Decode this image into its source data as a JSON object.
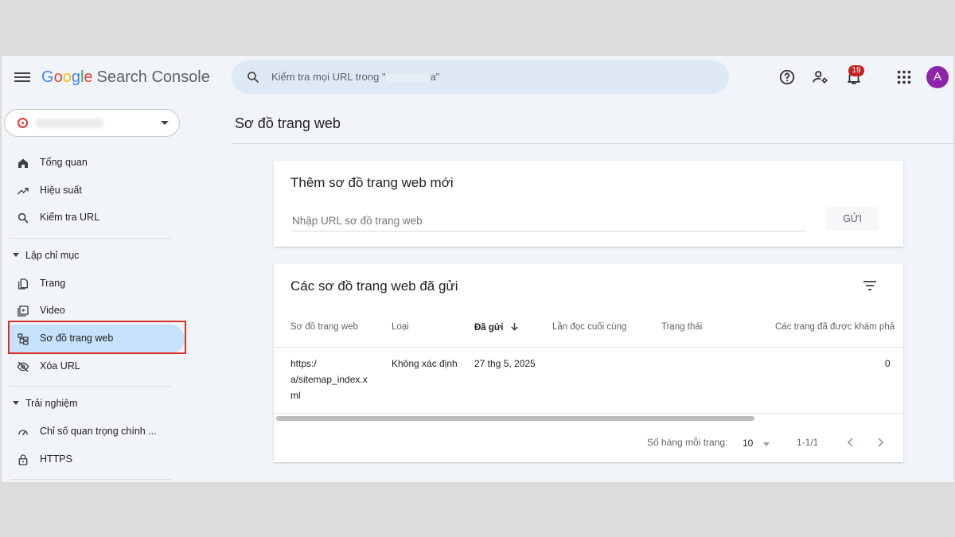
{
  "header": {
    "logo_google": [
      "G",
      "o",
      "o",
      "g",
      "l",
      "e"
    ],
    "logo_product": "Search Console",
    "search_prefix": "Kiểm tra mọi URL trong \"",
    "search_suffix": "a\"",
    "notification_count": "19",
    "avatar_letter": "A"
  },
  "sidebar": {
    "items_top": [
      {
        "label": "Tổng quan",
        "icon": "home-icon"
      },
      {
        "label": "Hiệu suất",
        "icon": "trending-up-icon"
      },
      {
        "label": "Kiểm tra URL",
        "icon": "search-icon"
      }
    ],
    "section_indexing": "Lập chỉ mục",
    "items_indexing": [
      {
        "label": "Trang",
        "icon": "pages-icon"
      },
      {
        "label": "Video",
        "icon": "video-icon"
      },
      {
        "label": "Sơ đồ trang web",
        "icon": "sitemap-icon",
        "active": true
      },
      {
        "label": "Xóa URL",
        "icon": "visibility-off-icon"
      }
    ],
    "section_experience": "Trải nghiệm",
    "items_experience": [
      {
        "label": "Chỉ số quan trọng chính ...",
        "icon": "speed-icon"
      },
      {
        "label": "HTTPS",
        "icon": "lock-icon"
      }
    ]
  },
  "main": {
    "page_title": "Sơ đồ trang web",
    "add_card": {
      "title": "Thêm sơ đồ trang web mới",
      "input_placeholder": "Nhập URL sơ đồ trang web",
      "submit_label": "GỬI"
    },
    "submitted_card": {
      "title": "Các sơ đồ trang web đã gửi",
      "columns": [
        "Sơ đồ trang web",
        "Loại",
        "Đã gửi",
        "Lần đọc cuối cùng",
        "Trạng thái",
        "Các trang đã được khám phá"
      ],
      "rows": [
        {
          "sitemap_line1": "https:/",
          "sitemap_line2": "a/sitemap_index.x",
          "sitemap_line3": "ml",
          "type": "Không xác định",
          "submitted": "27 thg 5, 2025",
          "last_read": "",
          "status": "",
          "discovered": "0"
        }
      ],
      "rows_per_page_label": "Số hàng mỗi trang:",
      "rows_per_page_value": "10",
      "range": "1-1/1"
    }
  }
}
